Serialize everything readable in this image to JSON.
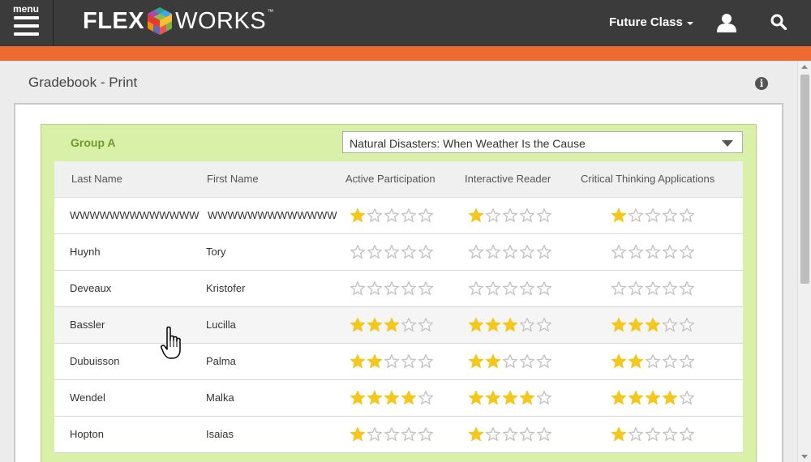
{
  "nav": {
    "menu_label": "menu",
    "logo_left": "FLEX",
    "logo_right": "WORKS",
    "logo_tm": "™",
    "class_name": "Future Class"
  },
  "page": {
    "title": "Gradebook - Print",
    "info": "i"
  },
  "group": {
    "name": "Group A",
    "unit": "Natural Disasters: When Weather Is the Cause"
  },
  "columns": [
    "Last Name",
    "First Name",
    "Active Participation",
    "Interactive Reader",
    "Critical Thinking Applications"
  ],
  "rating_max": 5,
  "rows": [
    {
      "last": "WWWWWWWWWWWWW",
      "first": "WWWWWWWWWWWWW",
      "ratings": [
        1,
        1,
        1
      ]
    },
    {
      "last": "Huynh",
      "first": "Tory",
      "ratings": [
        0,
        0,
        0
      ]
    },
    {
      "last": "Deveaux",
      "first": "Kristofer",
      "ratings": [
        0,
        0,
        0
      ]
    },
    {
      "last": "Bassler",
      "first": "Lucilla",
      "ratings": [
        3,
        3,
        3
      ]
    },
    {
      "last": "Dubuisson",
      "first": "Palma",
      "ratings": [
        2,
        2,
        2
      ]
    },
    {
      "last": "Wendel",
      "first": "Malka",
      "ratings": [
        4,
        4,
        4
      ]
    },
    {
      "last": "Hopton",
      "first": "Isaias",
      "ratings": [
        1,
        1,
        1
      ]
    }
  ],
  "colors": {
    "header_bg": "#3b3b3b",
    "accent_orange": "#ef6a30",
    "group_bg": "#d9f0a8",
    "group_text": "#6d9a2c",
    "star_filled": "#f3c71c",
    "star_empty": "#c4c4c4"
  }
}
